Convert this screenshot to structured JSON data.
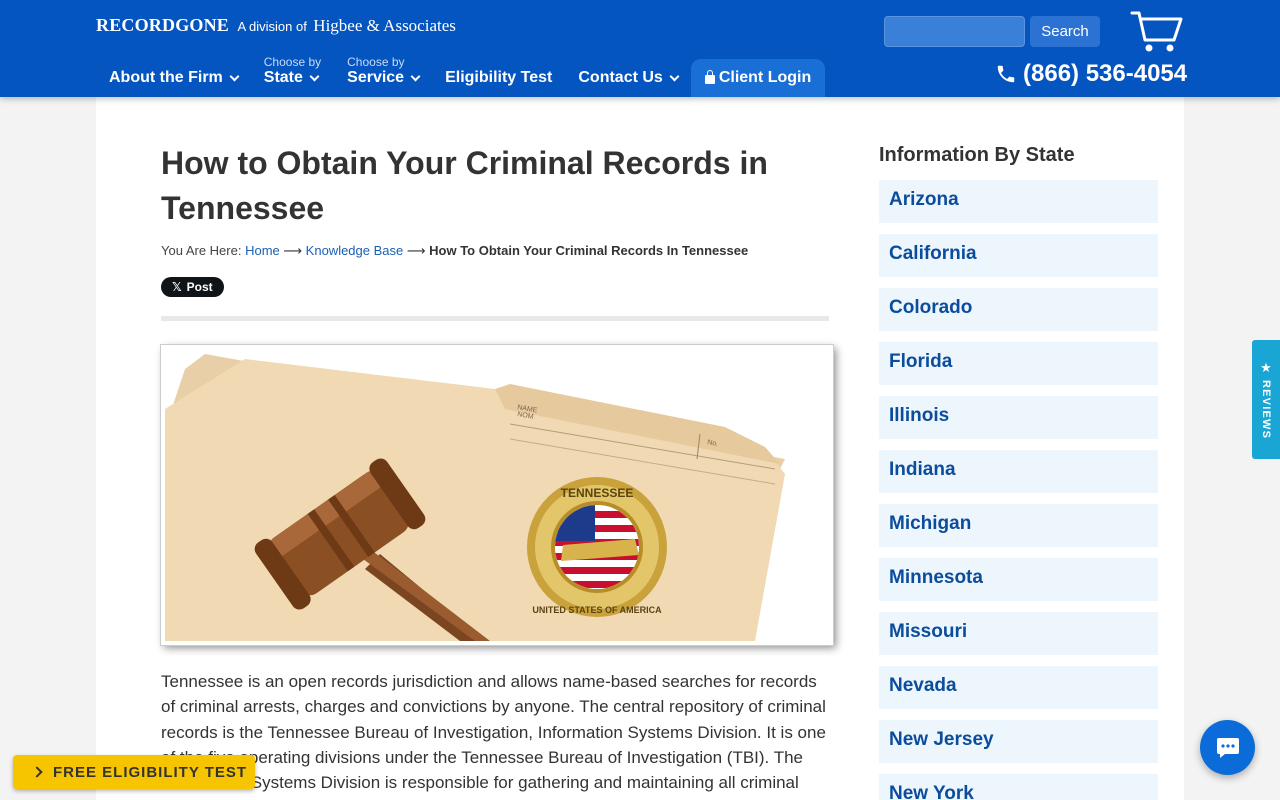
{
  "header": {
    "brand": "RECORDGONE",
    "brand_division": "A division of",
    "brand_parent": "Higbee & Associates",
    "search_placeholder": "",
    "search_button": "Search",
    "phone": "(866) 536-4054",
    "nav": [
      {
        "sub": "",
        "label": "About the Firm",
        "dropdown": true
      },
      {
        "sub": "Choose by",
        "label": "State",
        "dropdown": true
      },
      {
        "sub": "Choose by",
        "label": "Service",
        "dropdown": true
      },
      {
        "sub": "",
        "label": "Eligibility Test",
        "dropdown": false
      },
      {
        "sub": "",
        "label": "Contact Us",
        "dropdown": true
      },
      {
        "sub": "",
        "label": "Client Login",
        "dropdown": false
      }
    ]
  },
  "article": {
    "title": "How to Obtain Your Criminal Records in Tennessee",
    "breadcrumb": {
      "prefix": "You Are Here:",
      "home": "Home",
      "arrow": "⟶",
      "kb": "Knowledge Base",
      "current": "How To Obtain Your Criminal Records In Tennessee"
    },
    "x_post": "Post",
    "image": {
      "seal_top": "TENNESSEE",
      "seal_bottom": "UNITED STATES OF AMERICA",
      "folder_label_1": "NAME",
      "folder_label_2": "NOM",
      "folder_label_3": "No."
    },
    "body": "Tennessee is an open records jurisdiction and allows name-based searches for records of criminal arrests, charges and convictions by anyone. The central repository of criminal records is the Tennessee Bureau of Investigation, Information Systems Division. It is one of the five operating divisions under the Tennessee Bureau of Investigation (TBI). The Information Systems Division is responsible for gathering and maintaining all criminal records for the state. Tennessee criminal records include Tennessee arrest and"
  },
  "sidebar": {
    "heading": "Information By State",
    "states": [
      "Arizona",
      "California",
      "Colorado",
      "Florida",
      "Illinois",
      "Indiana",
      "Michigan",
      "Minnesota",
      "Missouri",
      "Nevada",
      "New Jersey",
      "New York"
    ]
  },
  "floating": {
    "reviews": "REVIEWS",
    "free_test": "FREE ELIGIBILITY TEST"
  },
  "colors": {
    "header_bg": "#0455c0",
    "accent_yellow": "#f7c500",
    "reviews_tab": "#1aa6d5",
    "state_item_bg": "#eef6fd"
  }
}
